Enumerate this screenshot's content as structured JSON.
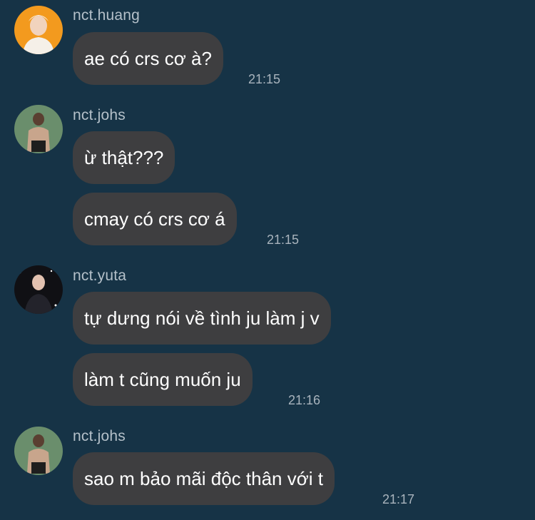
{
  "messages": [
    {
      "sender": "nct.huang",
      "avatar": "avatar-huang",
      "text": "ae có crs cơ à?",
      "time": "21:15"
    },
    {
      "sender": "nct.johs",
      "avatar": "avatar-johs",
      "text": "ừ thật???",
      "time": ""
    },
    {
      "sender": "",
      "avatar": "",
      "text": "cmay có crs cơ á",
      "time": "21:15"
    },
    {
      "sender": "nct.yuta",
      "avatar": "avatar-yuta",
      "text": "tự dưng nói về tình ju làm j v",
      "time": ""
    },
    {
      "sender": "",
      "avatar": "",
      "text": "làm t cũng muốn ju",
      "time": "21:16"
    },
    {
      "sender": "nct.johs",
      "avatar": "avatar-johs",
      "text": "sao m bảo mãi độc thân với t",
      "time": "21:17"
    }
  ],
  "colors": {
    "background": "#163346",
    "bubble": "#3e3e40",
    "text": "#ffffff",
    "sender": "#b4c0c9",
    "time": "#a9b4bd"
  }
}
